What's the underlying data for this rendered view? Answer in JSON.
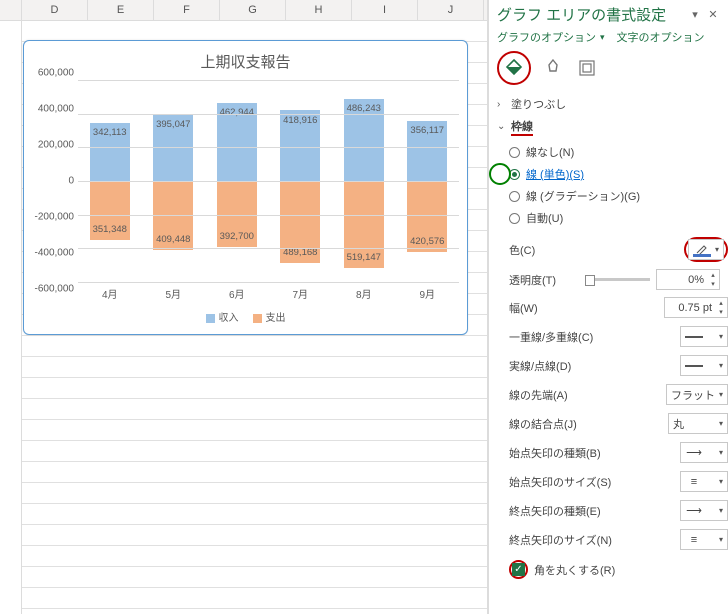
{
  "columns": [
    "D",
    "E",
    "F",
    "G",
    "H",
    "I",
    "J"
  ],
  "chart_data": {
    "type": "bar",
    "title": "上期収支報告",
    "categories": [
      "4月",
      "5月",
      "6月",
      "7月",
      "8月",
      "9月"
    ],
    "series": [
      {
        "name": "収入",
        "color": "#9dc3e6",
        "values": [
          342113,
          395047,
          462944,
          418916,
          486243,
          356117
        ]
      },
      {
        "name": "支出",
        "color": "#f4b183",
        "values": [
          -351348,
          -409448,
          -392700,
          -489168,
          -519147,
          -420576
        ]
      }
    ],
    "ylim": [
      -600000,
      600000
    ],
    "ytick": 200000,
    "xlabel": "",
    "ylabel": ""
  },
  "pane": {
    "title": "グラフ エリアの書式設定",
    "tab_chart_opts": "グラフのオプション",
    "tab_text_opts": "文字のオプション",
    "section_fill": "塗りつぶし",
    "section_border": "枠線",
    "border_none": "線なし(N)",
    "border_solid": "線 (単色)(S)",
    "border_gradient": "線 (グラデーション)(G)",
    "border_auto": "自動(U)",
    "p_color": "色(C)",
    "p_transparency": "透明度(T)",
    "p_width": "幅(W)",
    "p_compound": "一重線/多重線(C)",
    "p_dash": "実線/点線(D)",
    "p_cap": "線の先端(A)",
    "p_join": "線の結合点(J)",
    "p_begin_type": "始点矢印の種類(B)",
    "p_begin_size": "始点矢印のサイズ(S)",
    "p_end_type": "終点矢印の種類(E)",
    "p_end_size": "終点矢印のサイズ(N)",
    "p_round": "角を丸くする(R)",
    "v_transparency": "0%",
    "v_width": "0.75 pt",
    "v_cap": "フラット",
    "v_join": "丸"
  }
}
